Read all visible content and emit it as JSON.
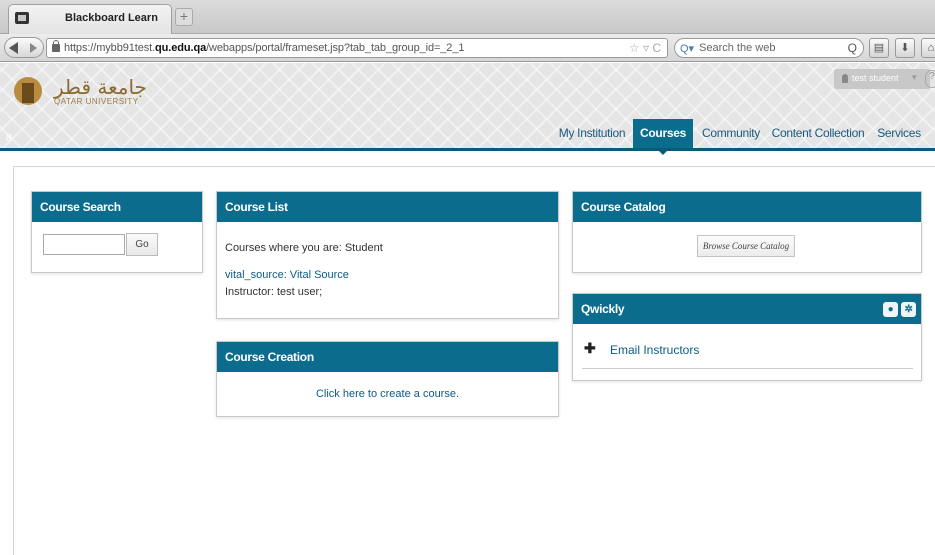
{
  "browser": {
    "tab_title": "Blackboard Learn",
    "new_tab_symbol": "+",
    "url_prefix": "https://mybb91test.",
    "url_domain": "qu.edu.qa",
    "url_path": "/webapps/portal/frameset.jsp?tab_tab_group_id=_2_1",
    "urlbar_icons": "☆ ▿ C",
    "search_placeholder": "Search the web",
    "search_engine_icon": "Q▾",
    "search_go_icon": "Q"
  },
  "header": {
    "logo_arabic": "جامعة قطر",
    "logo_english": "QATAR UNIVERSITY",
    "user_name": "test student",
    "user_caret": "▾",
    "help_glyph": "?",
    "edit_toggle": "8"
  },
  "nav_tabs": [
    {
      "label": "My Institution",
      "active": false
    },
    {
      "label": "Courses",
      "active": true
    },
    {
      "label": "Community",
      "active": false
    },
    {
      "label": "Content Collection",
      "active": false
    },
    {
      "label": "Services",
      "active": false
    }
  ],
  "modules": {
    "course_search": {
      "title": "Course Search",
      "input_value": "",
      "go_label": "Go"
    },
    "course_list": {
      "title": "Course List",
      "role_text": "Courses where you are: Student",
      "course_link": "vital_source: Vital Source",
      "instructor_text": "Instructor: test user;"
    },
    "course_creation": {
      "title": "Course Creation",
      "link_text": "Click here to create a course."
    },
    "course_catalog": {
      "title": "Course Catalog",
      "button_label": "Browse Course Catalog"
    },
    "qwickly": {
      "title": "Qwickly",
      "plus_glyph": "✚",
      "link_text": "Email Instructors",
      "icons": [
        "chat-icon",
        "gear-icon"
      ]
    }
  },
  "colors": {
    "module_header": "#0b6c8e",
    "link": "#0c5c86",
    "active_tab": "#0b6c8e"
  }
}
